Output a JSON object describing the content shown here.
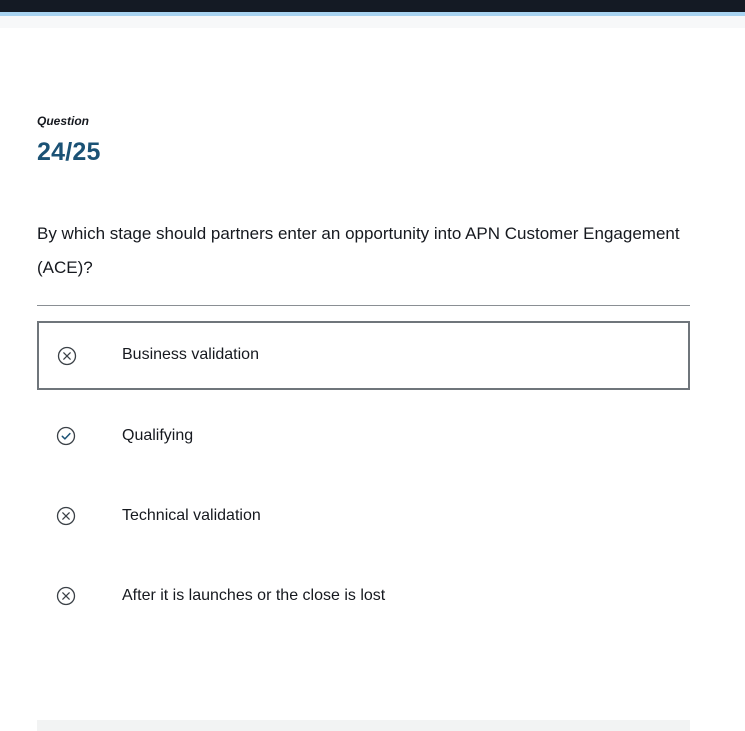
{
  "question": {
    "label": "Question",
    "counter": "24/25",
    "text": "By which stage should partners enter an opportunity into APN Customer Engagement (ACE)?"
  },
  "options": [
    {
      "label": "Business validation",
      "icon": "x-circle-icon",
      "selected": true
    },
    {
      "label": "Qualifying",
      "icon": "check-circle-icon",
      "selected": false
    },
    {
      "label": "Technical validation",
      "icon": "x-circle-icon",
      "selected": false
    },
    {
      "label": "After it is launches or the close is lost",
      "icon": "x-circle-icon",
      "selected": false
    }
  ],
  "colors": {
    "accent": "#1b5275",
    "header": "#141a24",
    "header_line": "#a8d3f0",
    "text": "#16191f"
  }
}
